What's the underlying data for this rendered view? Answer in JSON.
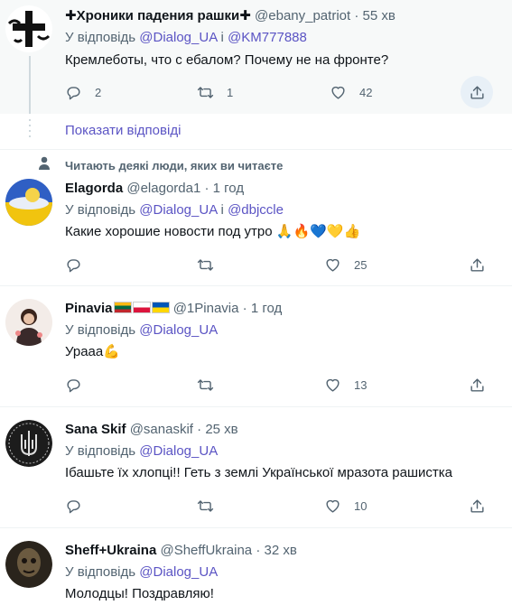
{
  "tweets": [
    {
      "name": "✚Хроники падения рашки✚",
      "handle": "@ebany_patriot",
      "dot": "·",
      "time": "55 хв",
      "reply_prefix": "У відповідь",
      "reply_user1": "@Dialog_UA",
      "reply_and": "і",
      "reply_user2": "@KM777888",
      "text": "Кремлеботы, что с ебалом? Почему не на фронте?",
      "replies": "2",
      "retweets": "1",
      "likes": "42"
    },
    {
      "name": "Elagorda",
      "handle": "@elagorda1",
      "dot": "·",
      "time": "1 год",
      "reply_prefix": "У відповідь",
      "reply_user1": "@Dialog_UA",
      "reply_and": "і",
      "reply_user2": "@dbjccle",
      "text": "Какие хорошие новости под утро",
      "emojis": "🙏🔥💙💛👍",
      "replies": "",
      "retweets": "",
      "likes": "25"
    },
    {
      "name": "Pinavia",
      "handle": "@1Pinavia",
      "dot": "·",
      "time": "1 год",
      "reply_prefix": "У відповідь",
      "reply_user1": "@Dialog_UA",
      "text": "Урааа",
      "emojis": "💪",
      "replies": "",
      "retweets": "",
      "likes": "13"
    },
    {
      "name": "Sana Skif",
      "handle": "@sanaskif",
      "dot": "·",
      "time": "25 хв",
      "reply_prefix": "У відповідь",
      "reply_user1": "@Dialog_UA",
      "text": "Ібашьте їх хлопці!! Геть з землі Української мразота рашистка",
      "replies": "",
      "retweets": "",
      "likes": "10"
    },
    {
      "name": "Sheff+Ukraina",
      "handle": "@SheffUkraina",
      "dot": "·",
      "time": "32 хв",
      "reply_prefix": "У відповідь",
      "reply_user1": "@Dialog_UA",
      "text": "Молодцы! Поздравляю!"
    }
  ],
  "show_replies": "Показати відповіді",
  "social_context": "Читають деякі люди, яких ви читаєте",
  "icons": {
    "reply": "reply-icon",
    "retweet": "retweet-icon",
    "like": "heart-icon",
    "share": "share-icon",
    "person": "person-icon"
  },
  "colors": {
    "link": "#5b54c4",
    "secondary_text": "#536471",
    "highlight_bg": "#f7f9f9"
  }
}
